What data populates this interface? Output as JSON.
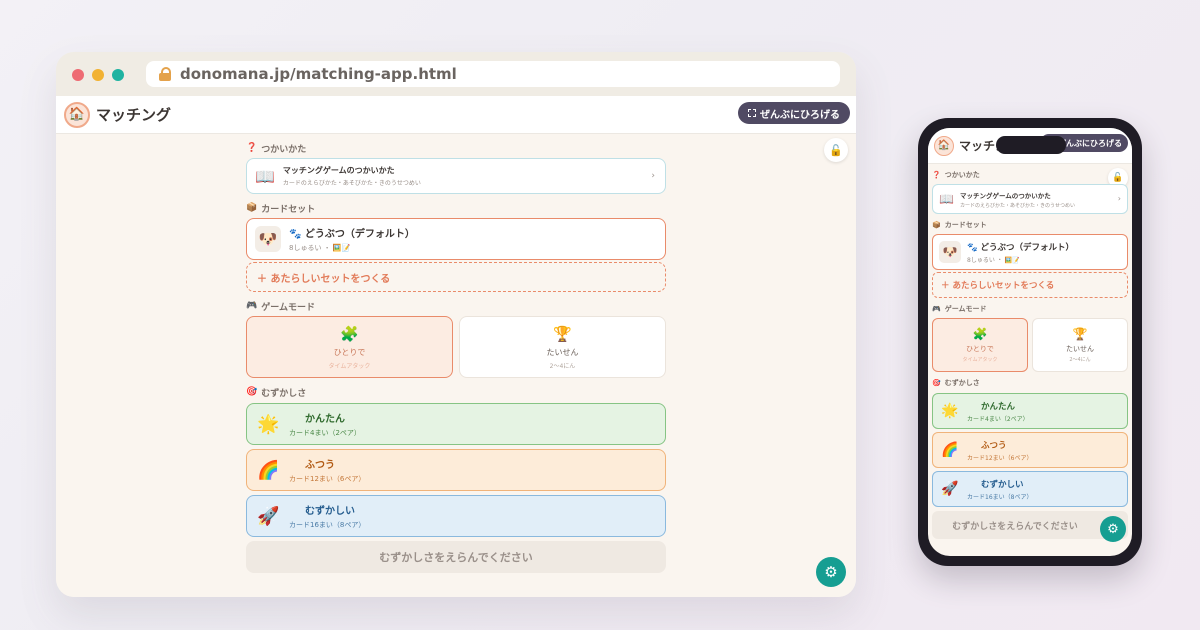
{
  "browser": {
    "url": "donomana.jp/matching-app.html"
  },
  "app": {
    "title": "マッチング",
    "fullscreen_label": "ぜんぶにひろげる",
    "logo_icon": "🏠",
    "lock_icon": "🔓",
    "gear_icon": "⚙"
  },
  "sections": {
    "howto": "つかいかた",
    "cardset": "カードセット",
    "mode": "ゲームモード",
    "difficulty": "むずかしさ"
  },
  "howto": {
    "title": "マッチングゲームのつかいかた",
    "subtitle": "カードのえらびかた・あそびかた・きのうせつめい",
    "icon": "📖"
  },
  "cardset": {
    "selected_name": "🐾 どうぶつ（デフォルト）",
    "selected_meta": "8しゅるい ・ 🖼️📝",
    "pet_icon": "🐶",
    "new_label": "＋ あたらしいセットをつくる"
  },
  "modes": [
    {
      "icon": "🧩",
      "label": "ひとりで",
      "sub": "タイムアタック",
      "selected": true
    },
    {
      "icon": "🏆",
      "label": "たいせん",
      "sub": "2〜4にん",
      "selected": false
    }
  ],
  "difficulties": [
    {
      "icon": "🌟",
      "label": "かんたん",
      "sub": "カード4まい（2ペア）"
    },
    {
      "icon": "🌈",
      "label": "ふつう",
      "sub": "カード12まい（6ペア）"
    },
    {
      "icon": "🚀",
      "label": "むずかしい",
      "sub": "カード16まい（8ペア）"
    }
  ],
  "start_label": "むずかしさをえらんでください",
  "colors": {
    "accent": "#e98b6a",
    "teal": "#169e92",
    "dark_button": "#504a63"
  }
}
